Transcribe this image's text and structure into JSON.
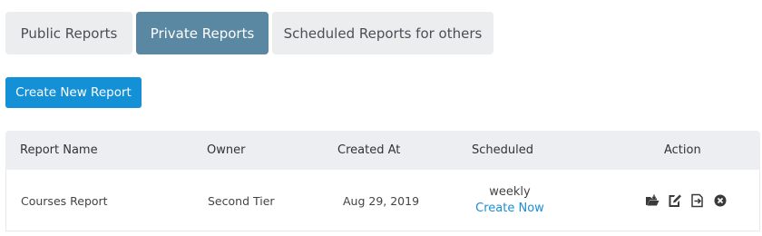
{
  "tabs": [
    {
      "label": "Public Reports"
    },
    {
      "label": "Private Reports"
    },
    {
      "label": "Scheduled Reports for others"
    }
  ],
  "active_tab": "Private Reports",
  "create_button": {
    "label": "Create New Report"
  },
  "table": {
    "headers": [
      "Report Name",
      "Owner",
      "Created At",
      "Scheduled",
      "Action"
    ],
    "rows": [
      {
        "report_name": "Courses Report",
        "owner": "Second Tier",
        "created_at": "Aug 29, 2019",
        "schedule_frequency": "weekly",
        "schedule_link": "Create Now",
        "actions": [
          "open-folder-icon",
          "edit-icon",
          "export-icon",
          "delete-icon"
        ]
      }
    ]
  },
  "colors": {
    "active_tab": "#5a87a1",
    "inactive_tab": "#ecedef",
    "primary_button": "#1490d6",
    "link": "#1a8fd4",
    "header_bg": "#eceef1"
  }
}
